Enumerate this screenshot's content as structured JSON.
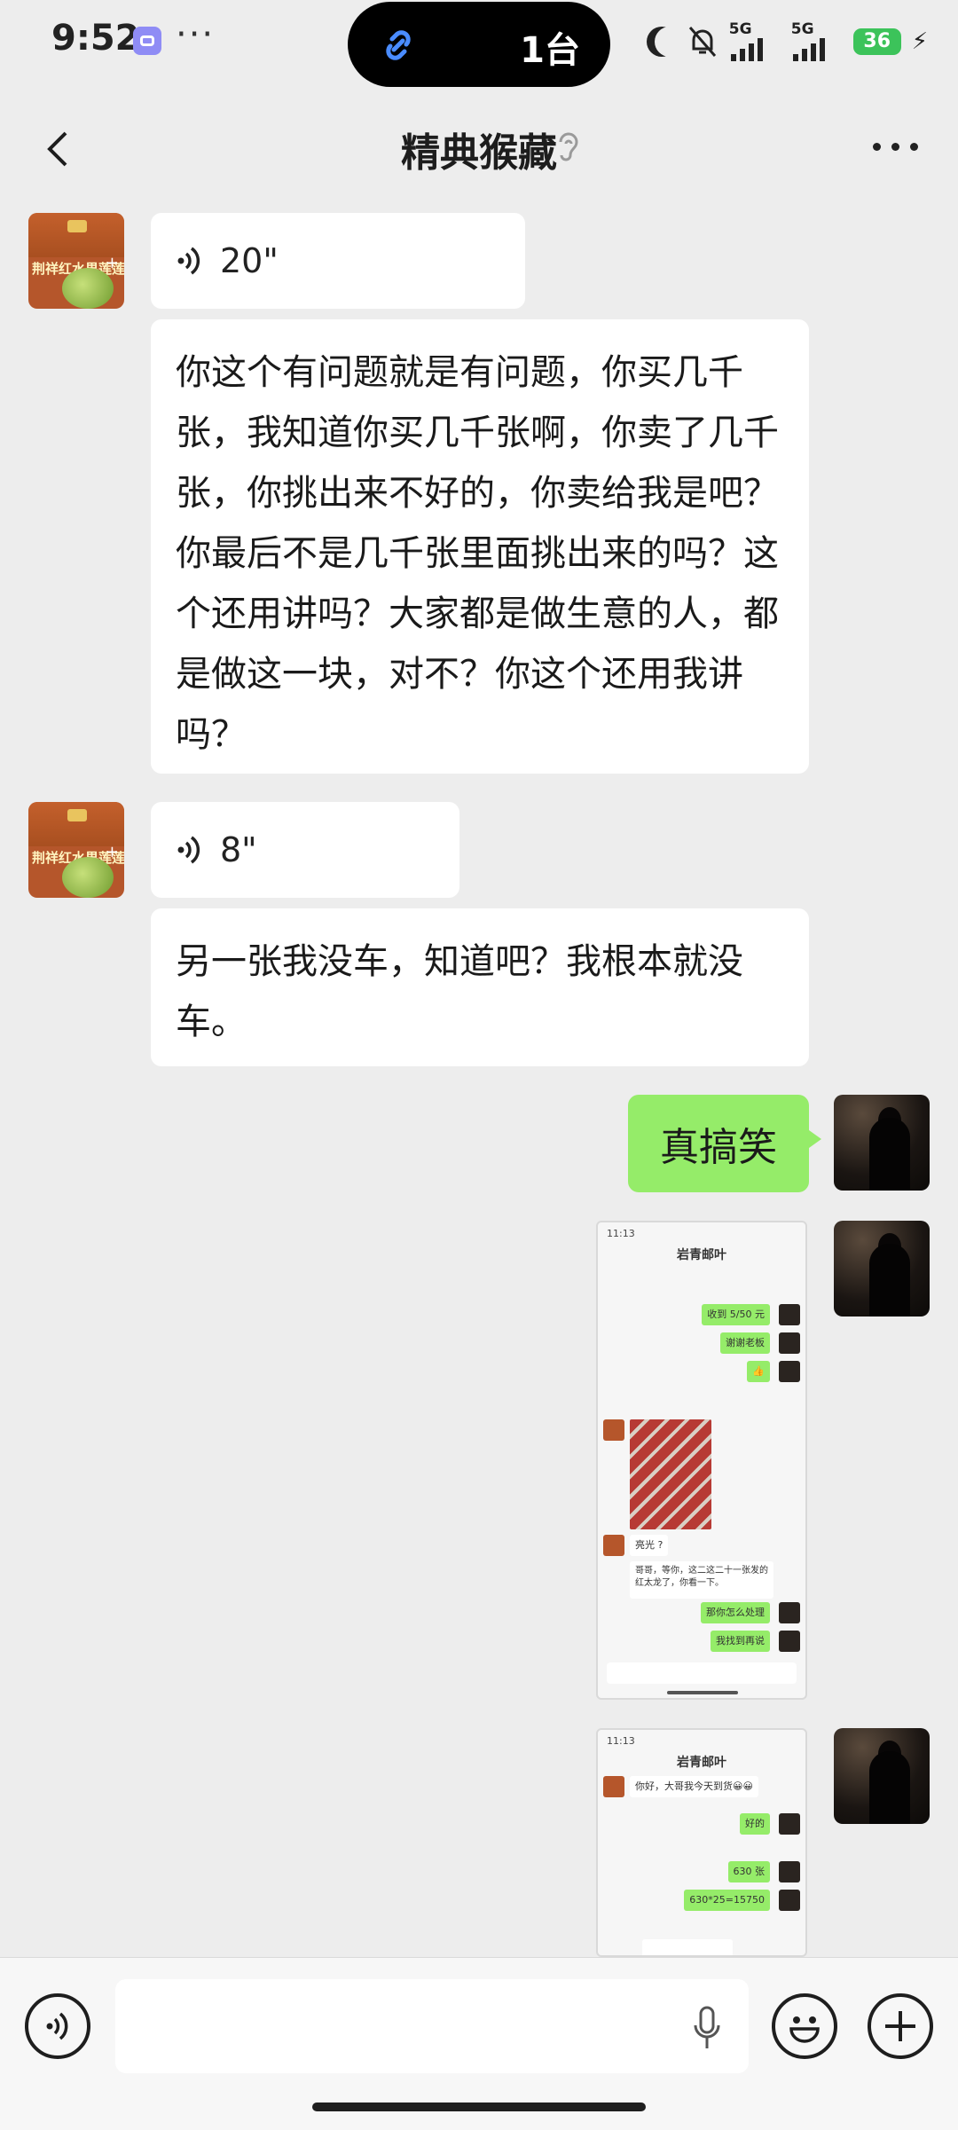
{
  "status_bar": {
    "time": "9:52",
    "more": "···",
    "island_text": "1台",
    "net1_label": "5G",
    "net2_label": "5G",
    "battery": "36"
  },
  "header": {
    "title": "精典猴藏"
  },
  "messages": [
    {
      "sender": "other",
      "type": "voice",
      "duration": "20\""
    },
    {
      "sender": "other",
      "type": "text",
      "text": "你这个有问题就是有问题，你买几千张，我知道你买几千张啊，你卖了几千张，你挑出来不好的，你卖给我是吧？你最后不是几千张里面挑出来的吗？这个还用讲吗？大家都是做生意的人，都是做这一块，对不？你这个还用我讲吗？"
    },
    {
      "sender": "other",
      "type": "voice",
      "duration": "8\""
    },
    {
      "sender": "other",
      "type": "text",
      "text": "另一张我没车，知道吧？我根本就没车。"
    },
    {
      "sender": "self",
      "type": "text",
      "text": "真搞笑"
    },
    {
      "sender": "self",
      "type": "image",
      "description": "chat screenshot 1"
    },
    {
      "sender": "self",
      "type": "image",
      "description": "chat screenshot 2"
    }
  ],
  "avatars": {
    "other_label": "荆祥红水果莲莲"
  },
  "shot1": {
    "time": "11:13",
    "title": "岩青邮叶",
    "rows": [
      "收到 5/50 元",
      "谢谢老板",
      "👍",
      "亮光 ?",
      "哥哥，等你，这二这二十一张发的红太龙了，你看一下。",
      "那你怎么处理",
      "我找到再说"
    ]
  },
  "shot2": {
    "time": "11:13",
    "title": "岩青邮叶",
    "rows": [
      "好的",
      "630 张",
      "630*25=15750"
    ],
    "first_row": "你好，大哥我今天到货😀😀"
  },
  "colors": {
    "accent_green": "#95ec69",
    "background": "#ededed",
    "bubble": "#ffffff"
  }
}
